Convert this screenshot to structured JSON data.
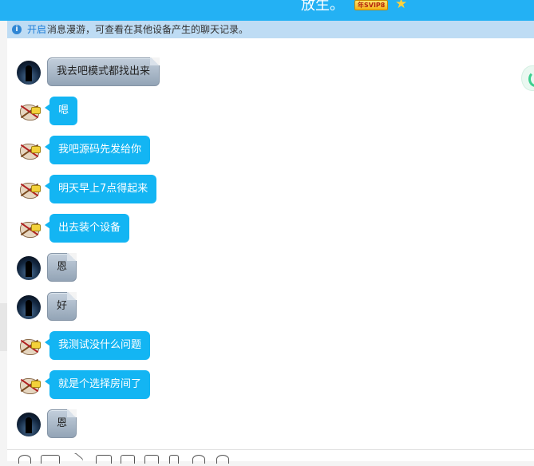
{
  "header": {
    "title": "放生。",
    "badge": "年SVIP8"
  },
  "notice": {
    "link": "开启",
    "text": "消息漫游，可查看在其他设备产生的聊天记录。"
  },
  "messages": [
    {
      "sender": "dark",
      "text": "我去吧模式都找出来"
    },
    {
      "sender": "cartoon",
      "text": "嗯"
    },
    {
      "sender": "cartoon",
      "text": "我吧源码先发给你"
    },
    {
      "sender": "cartoon",
      "text": "明天早上7点得起来"
    },
    {
      "sender": "cartoon",
      "text": "出去装个设备"
    },
    {
      "sender": "dark",
      "text": "恩"
    },
    {
      "sender": "dark",
      "text": "好"
    },
    {
      "sender": "cartoon",
      "text": "我测试没什么问题"
    },
    {
      "sender": "cartoon",
      "text": "就是个选择房间了"
    },
    {
      "sender": "dark",
      "text": "恩"
    }
  ],
  "toolbar": {
    "icons": [
      "emoji-icon",
      "gif-icon",
      "scissors-icon",
      "folder-icon",
      "image-icon",
      "video-icon",
      "phone-icon",
      "history-icon",
      "more-icon"
    ]
  },
  "colors": {
    "header": "#23b1f4",
    "bubble_blue": "#13b5f3",
    "notice_bg": "#bedcf4"
  }
}
